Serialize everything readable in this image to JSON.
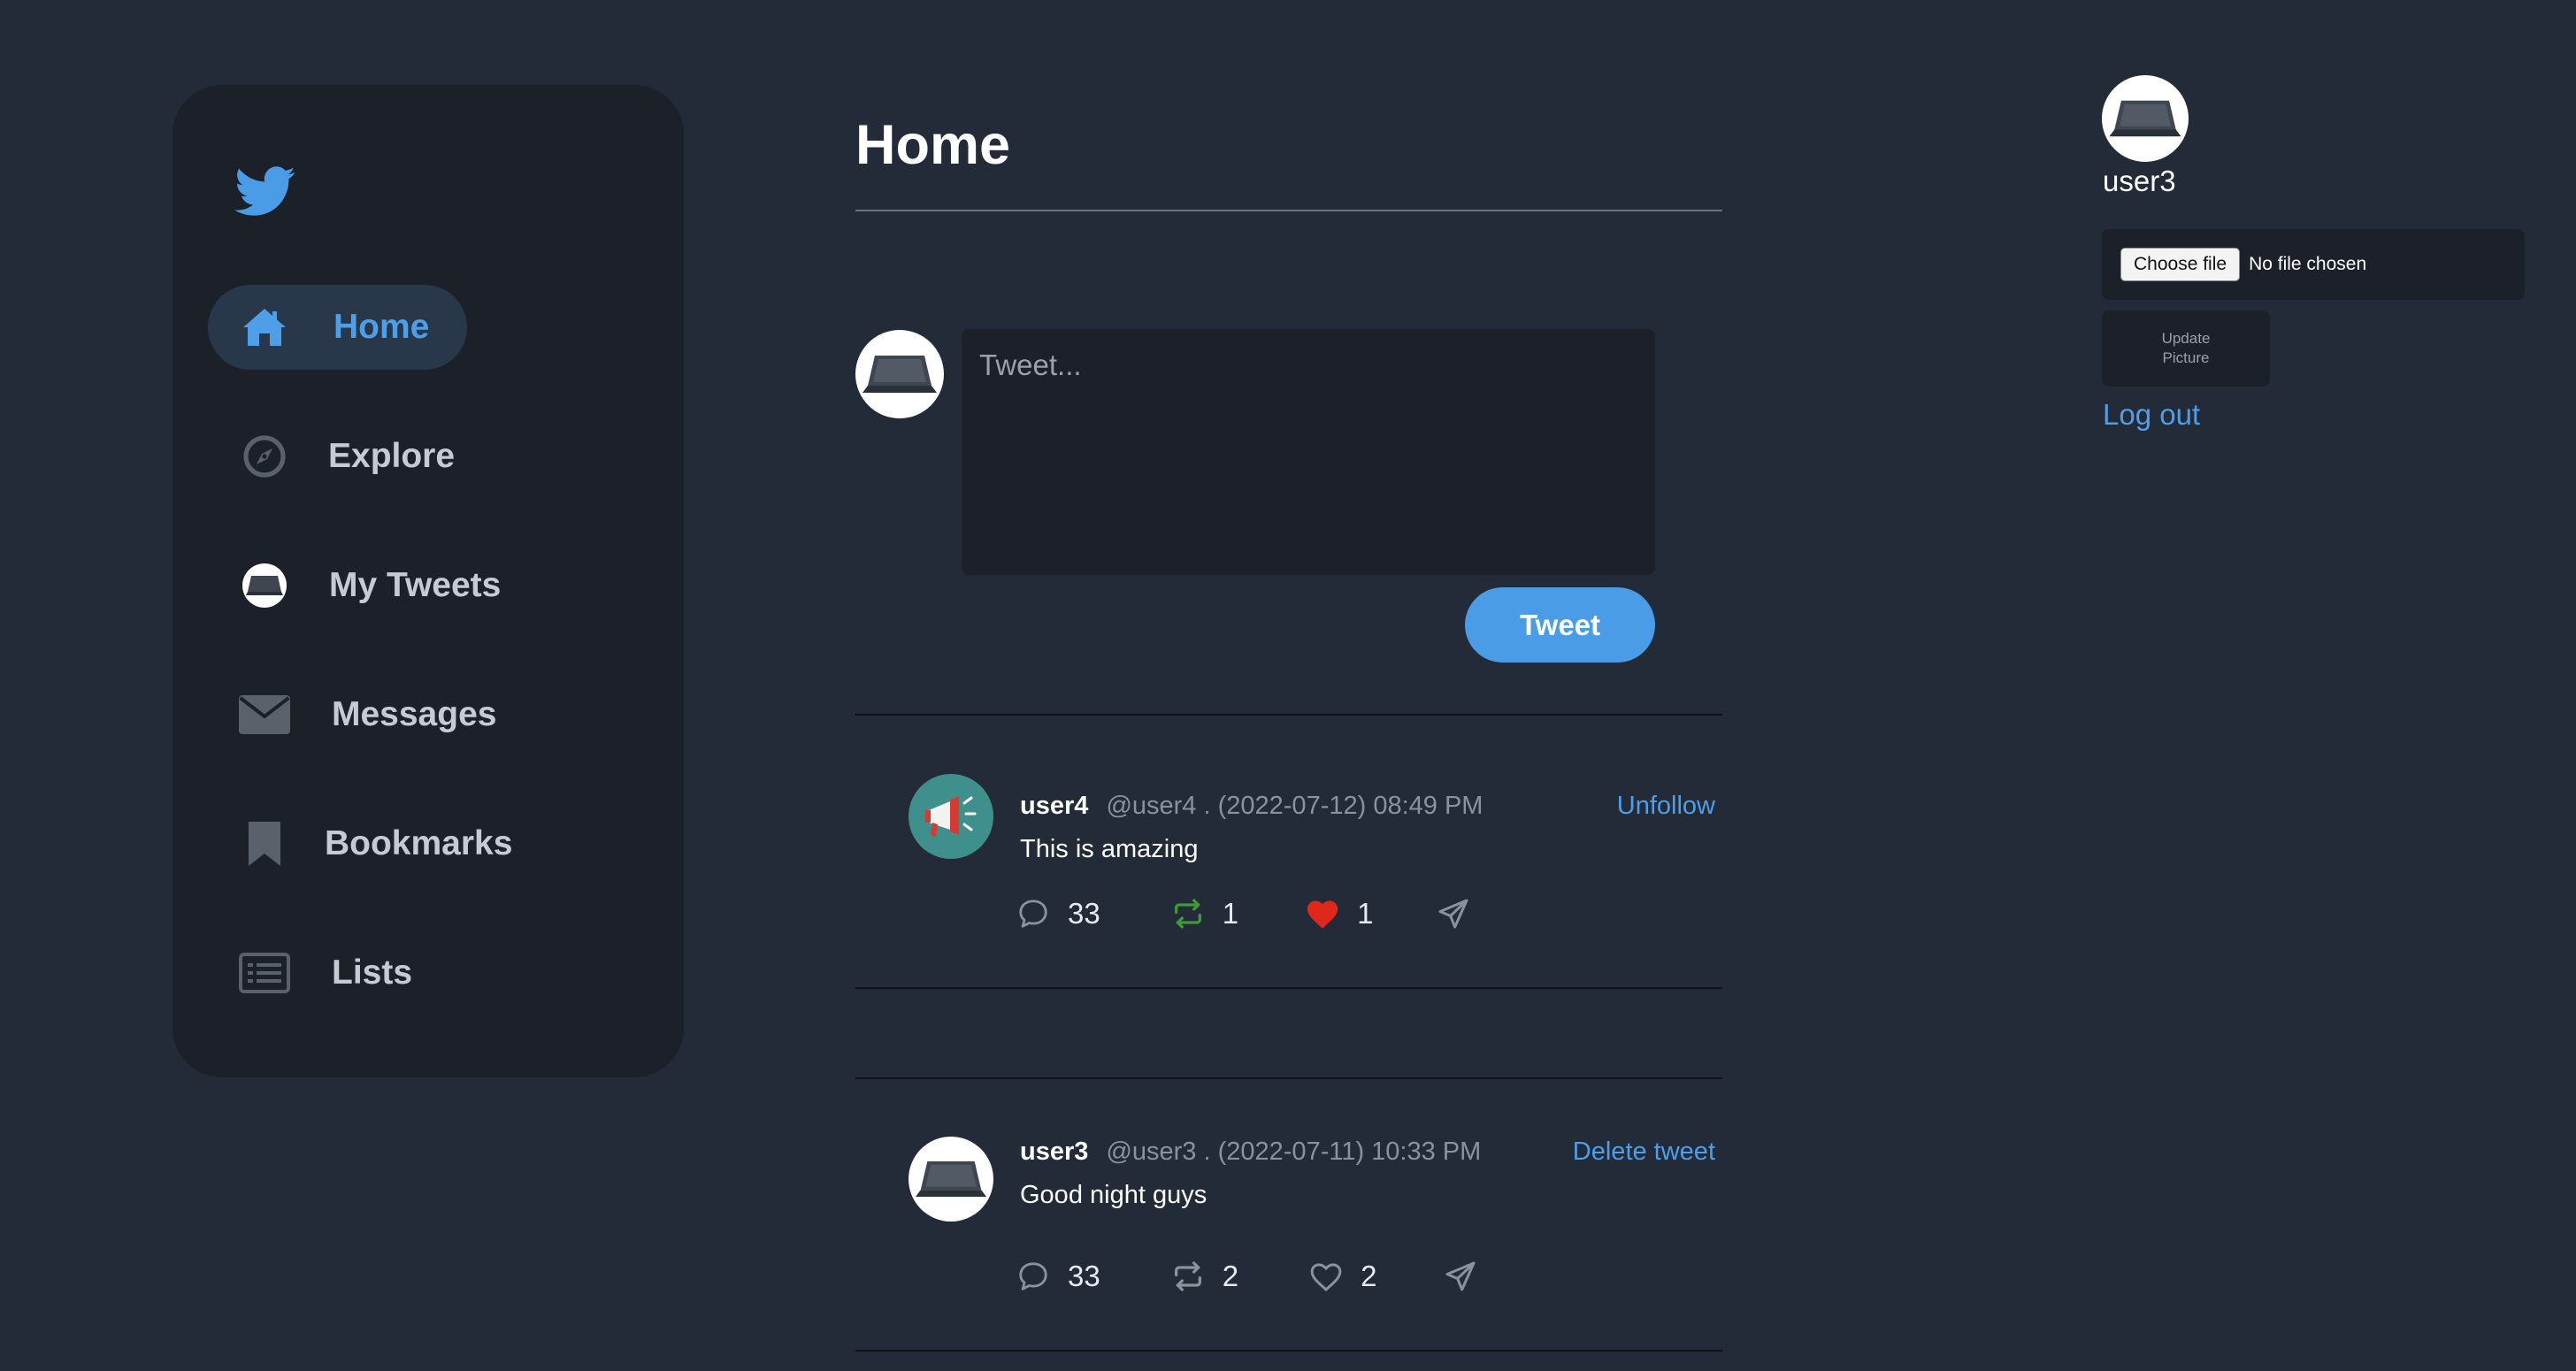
{
  "colors": {
    "background": "#232b38",
    "panel": "#1b2029",
    "accent": "#4b9ce6",
    "retweet_green": "#3f9a3a",
    "like_red": "#e0271b"
  },
  "sidebar": {
    "logo_icon": "twitter-bird-icon",
    "items": [
      {
        "label": "Home",
        "icon": "home-icon",
        "active": true
      },
      {
        "label": "Explore",
        "icon": "compass-icon",
        "active": false
      },
      {
        "label": "My Tweets",
        "icon": "user-avatar-icon",
        "active": false
      },
      {
        "label": "Messages",
        "icon": "envelope-icon",
        "active": false
      },
      {
        "label": "Bookmarks",
        "icon": "bookmark-icon",
        "active": false
      },
      {
        "label": "Lists",
        "icon": "list-icon",
        "active": false
      }
    ]
  },
  "main": {
    "title": "Home",
    "compose": {
      "placeholder": "Tweet...",
      "button_label": "Tweet"
    },
    "tweets": [
      {
        "user": "user4",
        "meta": "@user4 . (2022-07-12) 08:49 PM",
        "action": "Unfollow",
        "text": "This is amazing",
        "comments": "33",
        "retweets": "1",
        "likes": "1",
        "retweeted": true,
        "liked": true,
        "avatar_icon": "megaphone-icon"
      },
      {
        "user": "user3",
        "meta": "@user3 . (2022-07-11) 10:33 PM",
        "action": "Delete tweet",
        "text": "Good night guys",
        "comments": "33",
        "retweets": "2",
        "likes": "2",
        "retweeted": false,
        "liked": false,
        "avatar_icon": "laptop-icon"
      }
    ]
  },
  "profile": {
    "username": "user3",
    "choose_file_label": "Choose file",
    "no_file_text": "No file chosen",
    "update_picture_label": "Update\nPicture",
    "logout_label": "Log out"
  }
}
